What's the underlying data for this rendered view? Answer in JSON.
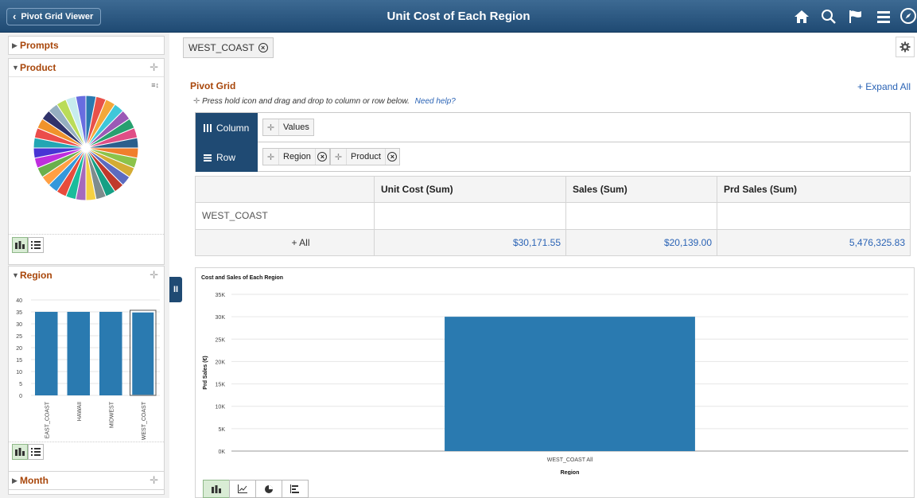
{
  "header": {
    "back_label": "Pivot Grid Viewer",
    "title": "Unit Cost of Each Region",
    "icons": [
      "home-icon",
      "search-icon",
      "flag-icon",
      "menu-icon",
      "compass-icon"
    ]
  },
  "left": {
    "prompts": {
      "title": "Prompts"
    },
    "product": {
      "title": "Product",
      "slice_colors": [
        "#2a7ab0",
        "#e8514a",
        "#f4a83a",
        "#3fc7d9",
        "#9b59b6",
        "#27a06f",
        "#e04f86",
        "#2b5f8c",
        "#f07f2c",
        "#8bc34a",
        "#d4ac34",
        "#5c6bc0",
        "#c0392b",
        "#16a085",
        "#7f8c8d",
        "#f5d142",
        "#a569bd",
        "#1abc9c",
        "#e74c3c",
        "#3498db",
        "#ff9f43",
        "#6ab04c",
        "#be2edd",
        "#4834d4",
        "#22a6b3",
        "#eb4d4b",
        "#f0932b",
        "#30336b",
        "#95afc0",
        "#badc58",
        "#c7ecee",
        "#686de0"
      ]
    },
    "region": {
      "title": "Region",
      "y_ticks": [
        "40",
        "35",
        "30",
        "25",
        "20",
        "15",
        "10",
        "5",
        "0"
      ],
      "categories": [
        "EAST_COAST",
        "HAWAII",
        "MIDWEST",
        "WEST_COAST"
      ],
      "values": [
        35,
        35,
        35,
        35
      ],
      "ymax": 40,
      "selected": "WEST_COAST",
      "bar_color": "#2a7ab0"
    },
    "month": {
      "title": "Month"
    }
  },
  "filter_chip": {
    "label": "WEST_COAST"
  },
  "pivot": {
    "title": "Pivot Grid",
    "expand_all": "+ Expand All",
    "hint": "Press hold icon and drag and drop to column or row below.",
    "help": "Need help?",
    "column_label": "Column",
    "row_label": "Row",
    "column_fields": [
      "Values"
    ],
    "row_fields": [
      "Region",
      "Product"
    ]
  },
  "grid": {
    "headers": [
      "",
      "Unit Cost (Sum)",
      "Sales (Sum)",
      "Prd Sales (Sum)"
    ],
    "group_label": "WEST_COAST",
    "all_label": "+ All",
    "values": [
      "$30,171.55",
      "$20,139.00",
      "5,476,325.83"
    ]
  },
  "chart_data": {
    "type": "bar",
    "title": "Cost and Sales of Each Region",
    "xlabel": "Region",
    "ylabel": "Prd Sales (€)",
    "categories": [
      "WEST_COAST All"
    ],
    "values": [
      30000
    ],
    "ylim": [
      0,
      35000
    ],
    "y_ticks": [
      "35K",
      "30K",
      "25K",
      "20K",
      "15K",
      "10K",
      "5K",
      "0K"
    ],
    "grid": true,
    "bar_color": "#2a7ab0"
  },
  "chart_types": [
    "bar-chart-icon",
    "line-chart-icon",
    "pie-chart-icon",
    "horizontal-bar-icon"
  ]
}
